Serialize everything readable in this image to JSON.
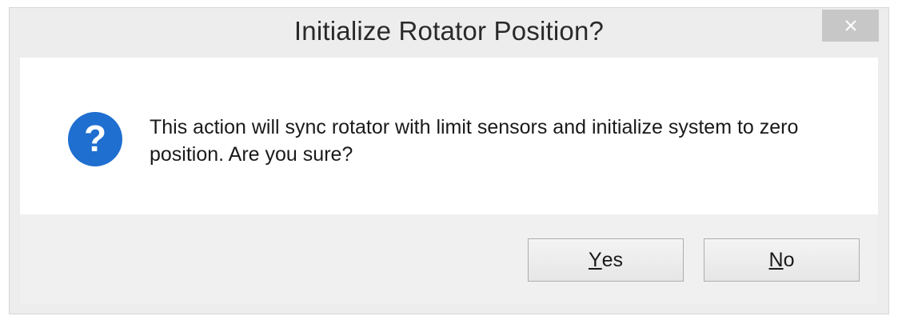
{
  "dialog": {
    "title": "Initialize Rotator Position?",
    "message": "This action will sync rotator with limit sensors and initialize system to zero position. Are you sure?",
    "icon": "question-icon",
    "buttons": {
      "yes": {
        "mnemonic": "Y",
        "rest": "es"
      },
      "no": {
        "mnemonic": "N",
        "rest": "o"
      }
    },
    "close_icon": "close-icon"
  },
  "colors": {
    "dialog_bg": "#ededed",
    "content_bg": "#ffffff",
    "icon_blue": "#1f6fd0",
    "close_bg": "#c7c7c7"
  }
}
